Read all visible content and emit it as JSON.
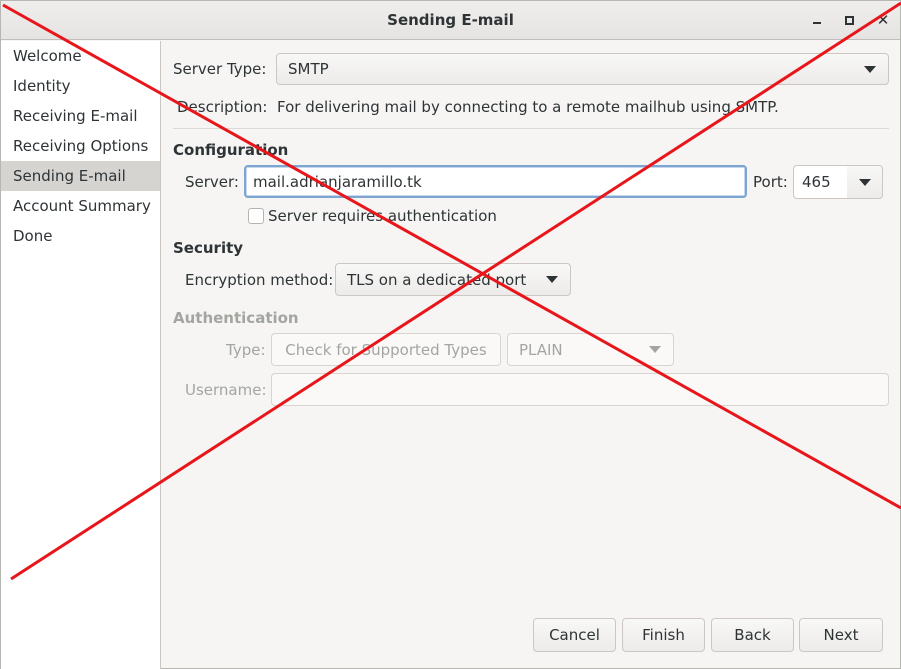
{
  "window": {
    "title": "Sending E-mail"
  },
  "sidebar": {
    "items": [
      {
        "label": "Welcome"
      },
      {
        "label": "Identity"
      },
      {
        "label": "Receiving E-mail"
      },
      {
        "label": "Receiving Options"
      },
      {
        "label": "Sending E-mail",
        "active": true
      },
      {
        "label": "Account Summary"
      },
      {
        "label": "Done"
      }
    ]
  },
  "server_type": {
    "label": "Server Type:",
    "value": "SMTP"
  },
  "description": {
    "label": "Description:",
    "value": "For delivering mail by connecting to a remote mailhub using SMTP."
  },
  "configuration": {
    "heading": "Configuration",
    "server_label": "Server:",
    "server_value": "mail.adrianjaramillo.tk",
    "port_label": "Port:",
    "port_value": "465",
    "auth_checkbox_label": "Server requires authentication",
    "auth_checked": false
  },
  "security": {
    "heading": "Security",
    "encryption_label": "Encryption method:",
    "encryption_value": "TLS on a dedicated port"
  },
  "authentication": {
    "heading": "Authentication",
    "type_label": "Type:",
    "check_button": "Check for Supported Types",
    "type_value": "PLAIN",
    "username_label": "Username:",
    "username_value": ""
  },
  "buttons": {
    "cancel": "Cancel",
    "finish": "Finish",
    "back": "Back",
    "next": "Next"
  },
  "overlay": {
    "color": "#e8161b"
  }
}
